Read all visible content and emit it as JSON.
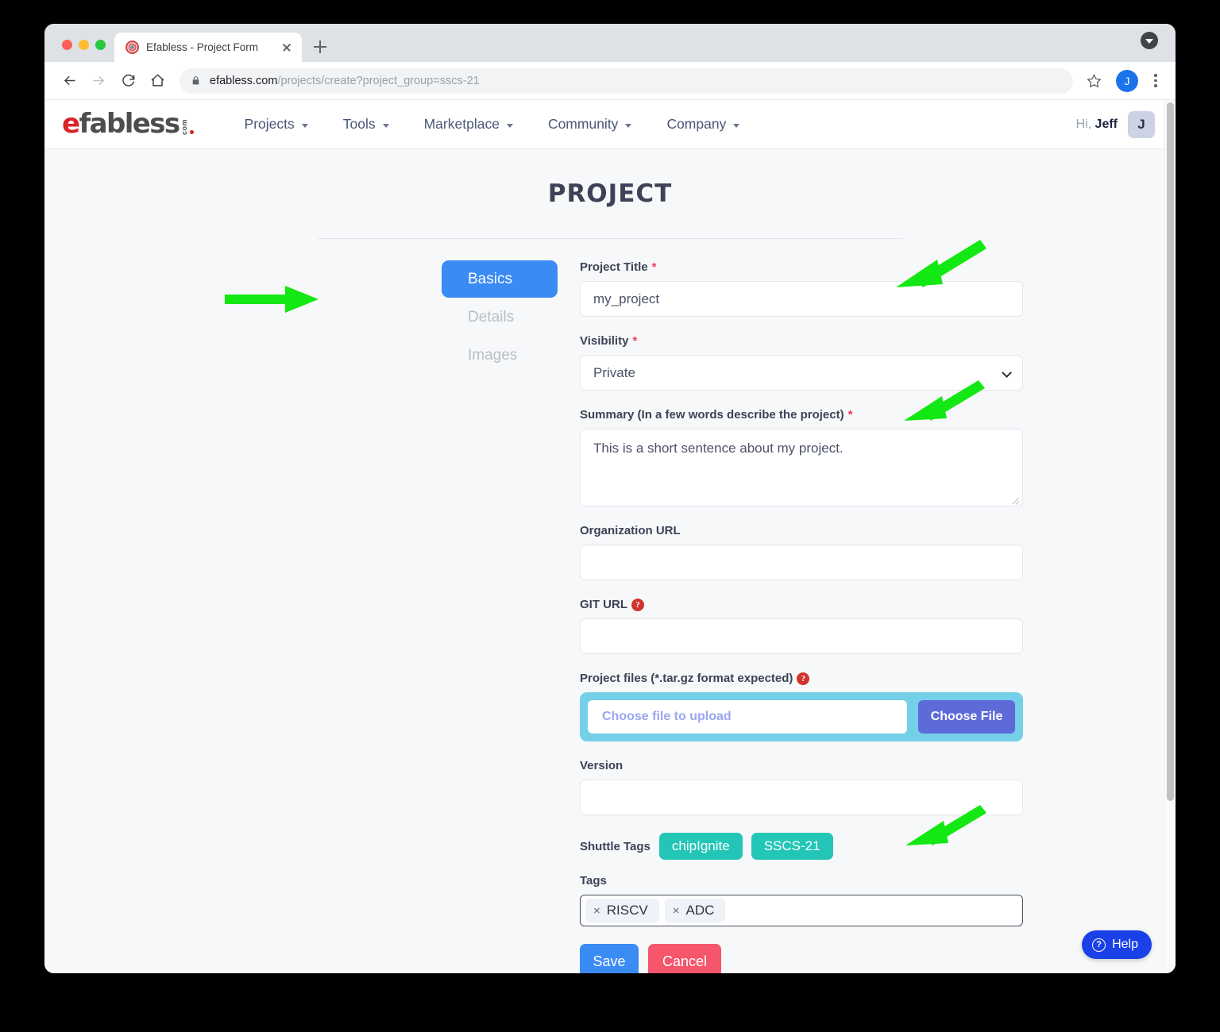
{
  "browser": {
    "tab_title": "Efabless - Project Form",
    "url_domain": "efabless.com",
    "url_path": "/projects/create?project_group=sscs-21",
    "profile_initial": "J",
    "icons": {
      "back": "back-arrow-icon",
      "forward": "forward-arrow-icon",
      "reload": "reload-icon",
      "home": "home-icon",
      "lock": "lock-icon",
      "bookmark": "star-icon",
      "menu": "kebab-menu-icon",
      "new_tab": "plus-icon",
      "close_tab": "close-icon",
      "window_dropdown": "caret-down-icon"
    }
  },
  "site_header": {
    "logo": {
      "e": "e",
      "rest": "fabless",
      "dotcom": "com"
    },
    "nav": [
      {
        "label": "Projects",
        "has_caret": true
      },
      {
        "label": "Tools",
        "has_caret": true
      },
      {
        "label": "Marketplace",
        "has_caret": true
      },
      {
        "label": "Community",
        "has_caret": true
      },
      {
        "label": "Company",
        "has_caret": true
      }
    ],
    "greeting_prefix": "Hi,",
    "greeting_name": "Jeff",
    "avatar_initial": "J"
  },
  "page": {
    "title": "PROJECT"
  },
  "tabs": [
    {
      "label": "Basics",
      "active": true
    },
    {
      "label": "Details",
      "active": false
    },
    {
      "label": "Images",
      "active": false
    }
  ],
  "form": {
    "project_title": {
      "label": "Project Title",
      "required": "*",
      "value": "my_project"
    },
    "visibility": {
      "label": "Visibility",
      "required": "*",
      "selected": "Private"
    },
    "summary": {
      "label": "Summary (In a few words describe the project)",
      "required": "*",
      "value": "This is a short sentence about my project."
    },
    "organization_url": {
      "label": "Organization URL",
      "value": ""
    },
    "git_url": {
      "label": "GIT URL",
      "help": "?",
      "value": ""
    },
    "project_files": {
      "label": "Project files (*.tar.gz format expected)",
      "help": "?",
      "placeholder": "Choose file to upload",
      "button": "Choose File"
    },
    "version": {
      "label": "Version",
      "value": ""
    },
    "shuttle_tags": {
      "label": "Shuttle Tags",
      "chips": [
        "chipIgnite",
        "SSCS-21"
      ]
    },
    "tags": {
      "label": "Tags",
      "chips": [
        "RISCV",
        "ADC"
      ],
      "remove_glyph": "×"
    },
    "actions": {
      "save": "Save",
      "cancel": "Cancel"
    }
  },
  "help_widget": {
    "label": "Help",
    "icon_glyph": "?"
  },
  "annotations": {
    "color": "#14e814",
    "arrows": [
      {
        "name": "arrow-to-details-tab",
        "direction": "right"
      },
      {
        "name": "arrow-to-project-title-field",
        "direction": "down-left"
      },
      {
        "name": "arrow-to-summary-field",
        "direction": "down-left"
      },
      {
        "name": "arrow-to-tags-field",
        "direction": "down-left"
      }
    ]
  },
  "colors": {
    "accent_blue": "#3b8bf5",
    "danger_red": "#f5566b",
    "teal_chip": "#23c6b6",
    "upload_band": "#74cfe8",
    "choose_file": "#5e6ad8",
    "help_blue": "#1a41e8",
    "logo_red": "#d8232a",
    "annotation_green": "#14e814"
  }
}
